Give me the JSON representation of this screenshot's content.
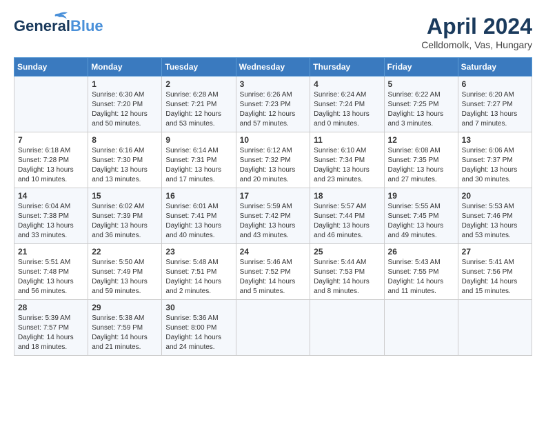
{
  "logo": {
    "line1": "General",
    "line2": "Blue"
  },
  "title": "April 2024",
  "subtitle": "Celldomolk, Vas, Hungary",
  "headers": [
    "Sunday",
    "Monday",
    "Tuesday",
    "Wednesday",
    "Thursday",
    "Friday",
    "Saturday"
  ],
  "weeks": [
    [
      {
        "day": "",
        "info": ""
      },
      {
        "day": "1",
        "info": "Sunrise: 6:30 AM\nSunset: 7:20 PM\nDaylight: 12 hours\nand 50 minutes."
      },
      {
        "day": "2",
        "info": "Sunrise: 6:28 AM\nSunset: 7:21 PM\nDaylight: 12 hours\nand 53 minutes."
      },
      {
        "day": "3",
        "info": "Sunrise: 6:26 AM\nSunset: 7:23 PM\nDaylight: 12 hours\nand 57 minutes."
      },
      {
        "day": "4",
        "info": "Sunrise: 6:24 AM\nSunset: 7:24 PM\nDaylight: 13 hours\nand 0 minutes."
      },
      {
        "day": "5",
        "info": "Sunrise: 6:22 AM\nSunset: 7:25 PM\nDaylight: 13 hours\nand 3 minutes."
      },
      {
        "day": "6",
        "info": "Sunrise: 6:20 AM\nSunset: 7:27 PM\nDaylight: 13 hours\nand 7 minutes."
      }
    ],
    [
      {
        "day": "7",
        "info": "Sunrise: 6:18 AM\nSunset: 7:28 PM\nDaylight: 13 hours\nand 10 minutes."
      },
      {
        "day": "8",
        "info": "Sunrise: 6:16 AM\nSunset: 7:30 PM\nDaylight: 13 hours\nand 13 minutes."
      },
      {
        "day": "9",
        "info": "Sunrise: 6:14 AM\nSunset: 7:31 PM\nDaylight: 13 hours\nand 17 minutes."
      },
      {
        "day": "10",
        "info": "Sunrise: 6:12 AM\nSunset: 7:32 PM\nDaylight: 13 hours\nand 20 minutes."
      },
      {
        "day": "11",
        "info": "Sunrise: 6:10 AM\nSunset: 7:34 PM\nDaylight: 13 hours\nand 23 minutes."
      },
      {
        "day": "12",
        "info": "Sunrise: 6:08 AM\nSunset: 7:35 PM\nDaylight: 13 hours\nand 27 minutes."
      },
      {
        "day": "13",
        "info": "Sunrise: 6:06 AM\nSunset: 7:37 PM\nDaylight: 13 hours\nand 30 minutes."
      }
    ],
    [
      {
        "day": "14",
        "info": "Sunrise: 6:04 AM\nSunset: 7:38 PM\nDaylight: 13 hours\nand 33 minutes."
      },
      {
        "day": "15",
        "info": "Sunrise: 6:02 AM\nSunset: 7:39 PM\nDaylight: 13 hours\nand 36 minutes."
      },
      {
        "day": "16",
        "info": "Sunrise: 6:01 AM\nSunset: 7:41 PM\nDaylight: 13 hours\nand 40 minutes."
      },
      {
        "day": "17",
        "info": "Sunrise: 5:59 AM\nSunset: 7:42 PM\nDaylight: 13 hours\nand 43 minutes."
      },
      {
        "day": "18",
        "info": "Sunrise: 5:57 AM\nSunset: 7:44 PM\nDaylight: 13 hours\nand 46 minutes."
      },
      {
        "day": "19",
        "info": "Sunrise: 5:55 AM\nSunset: 7:45 PM\nDaylight: 13 hours\nand 49 minutes."
      },
      {
        "day": "20",
        "info": "Sunrise: 5:53 AM\nSunset: 7:46 PM\nDaylight: 13 hours\nand 53 minutes."
      }
    ],
    [
      {
        "day": "21",
        "info": "Sunrise: 5:51 AM\nSunset: 7:48 PM\nDaylight: 13 hours\nand 56 minutes."
      },
      {
        "day": "22",
        "info": "Sunrise: 5:50 AM\nSunset: 7:49 PM\nDaylight: 13 hours\nand 59 minutes."
      },
      {
        "day": "23",
        "info": "Sunrise: 5:48 AM\nSunset: 7:51 PM\nDaylight: 14 hours\nand 2 minutes."
      },
      {
        "day": "24",
        "info": "Sunrise: 5:46 AM\nSunset: 7:52 PM\nDaylight: 14 hours\nand 5 minutes."
      },
      {
        "day": "25",
        "info": "Sunrise: 5:44 AM\nSunset: 7:53 PM\nDaylight: 14 hours\nand 8 minutes."
      },
      {
        "day": "26",
        "info": "Sunrise: 5:43 AM\nSunset: 7:55 PM\nDaylight: 14 hours\nand 11 minutes."
      },
      {
        "day": "27",
        "info": "Sunrise: 5:41 AM\nSunset: 7:56 PM\nDaylight: 14 hours\nand 15 minutes."
      }
    ],
    [
      {
        "day": "28",
        "info": "Sunrise: 5:39 AM\nSunset: 7:57 PM\nDaylight: 14 hours\nand 18 minutes."
      },
      {
        "day": "29",
        "info": "Sunrise: 5:38 AM\nSunset: 7:59 PM\nDaylight: 14 hours\nand 21 minutes."
      },
      {
        "day": "30",
        "info": "Sunrise: 5:36 AM\nSunset: 8:00 PM\nDaylight: 14 hours\nand 24 minutes."
      },
      {
        "day": "",
        "info": ""
      },
      {
        "day": "",
        "info": ""
      },
      {
        "day": "",
        "info": ""
      },
      {
        "day": "",
        "info": ""
      }
    ]
  ]
}
